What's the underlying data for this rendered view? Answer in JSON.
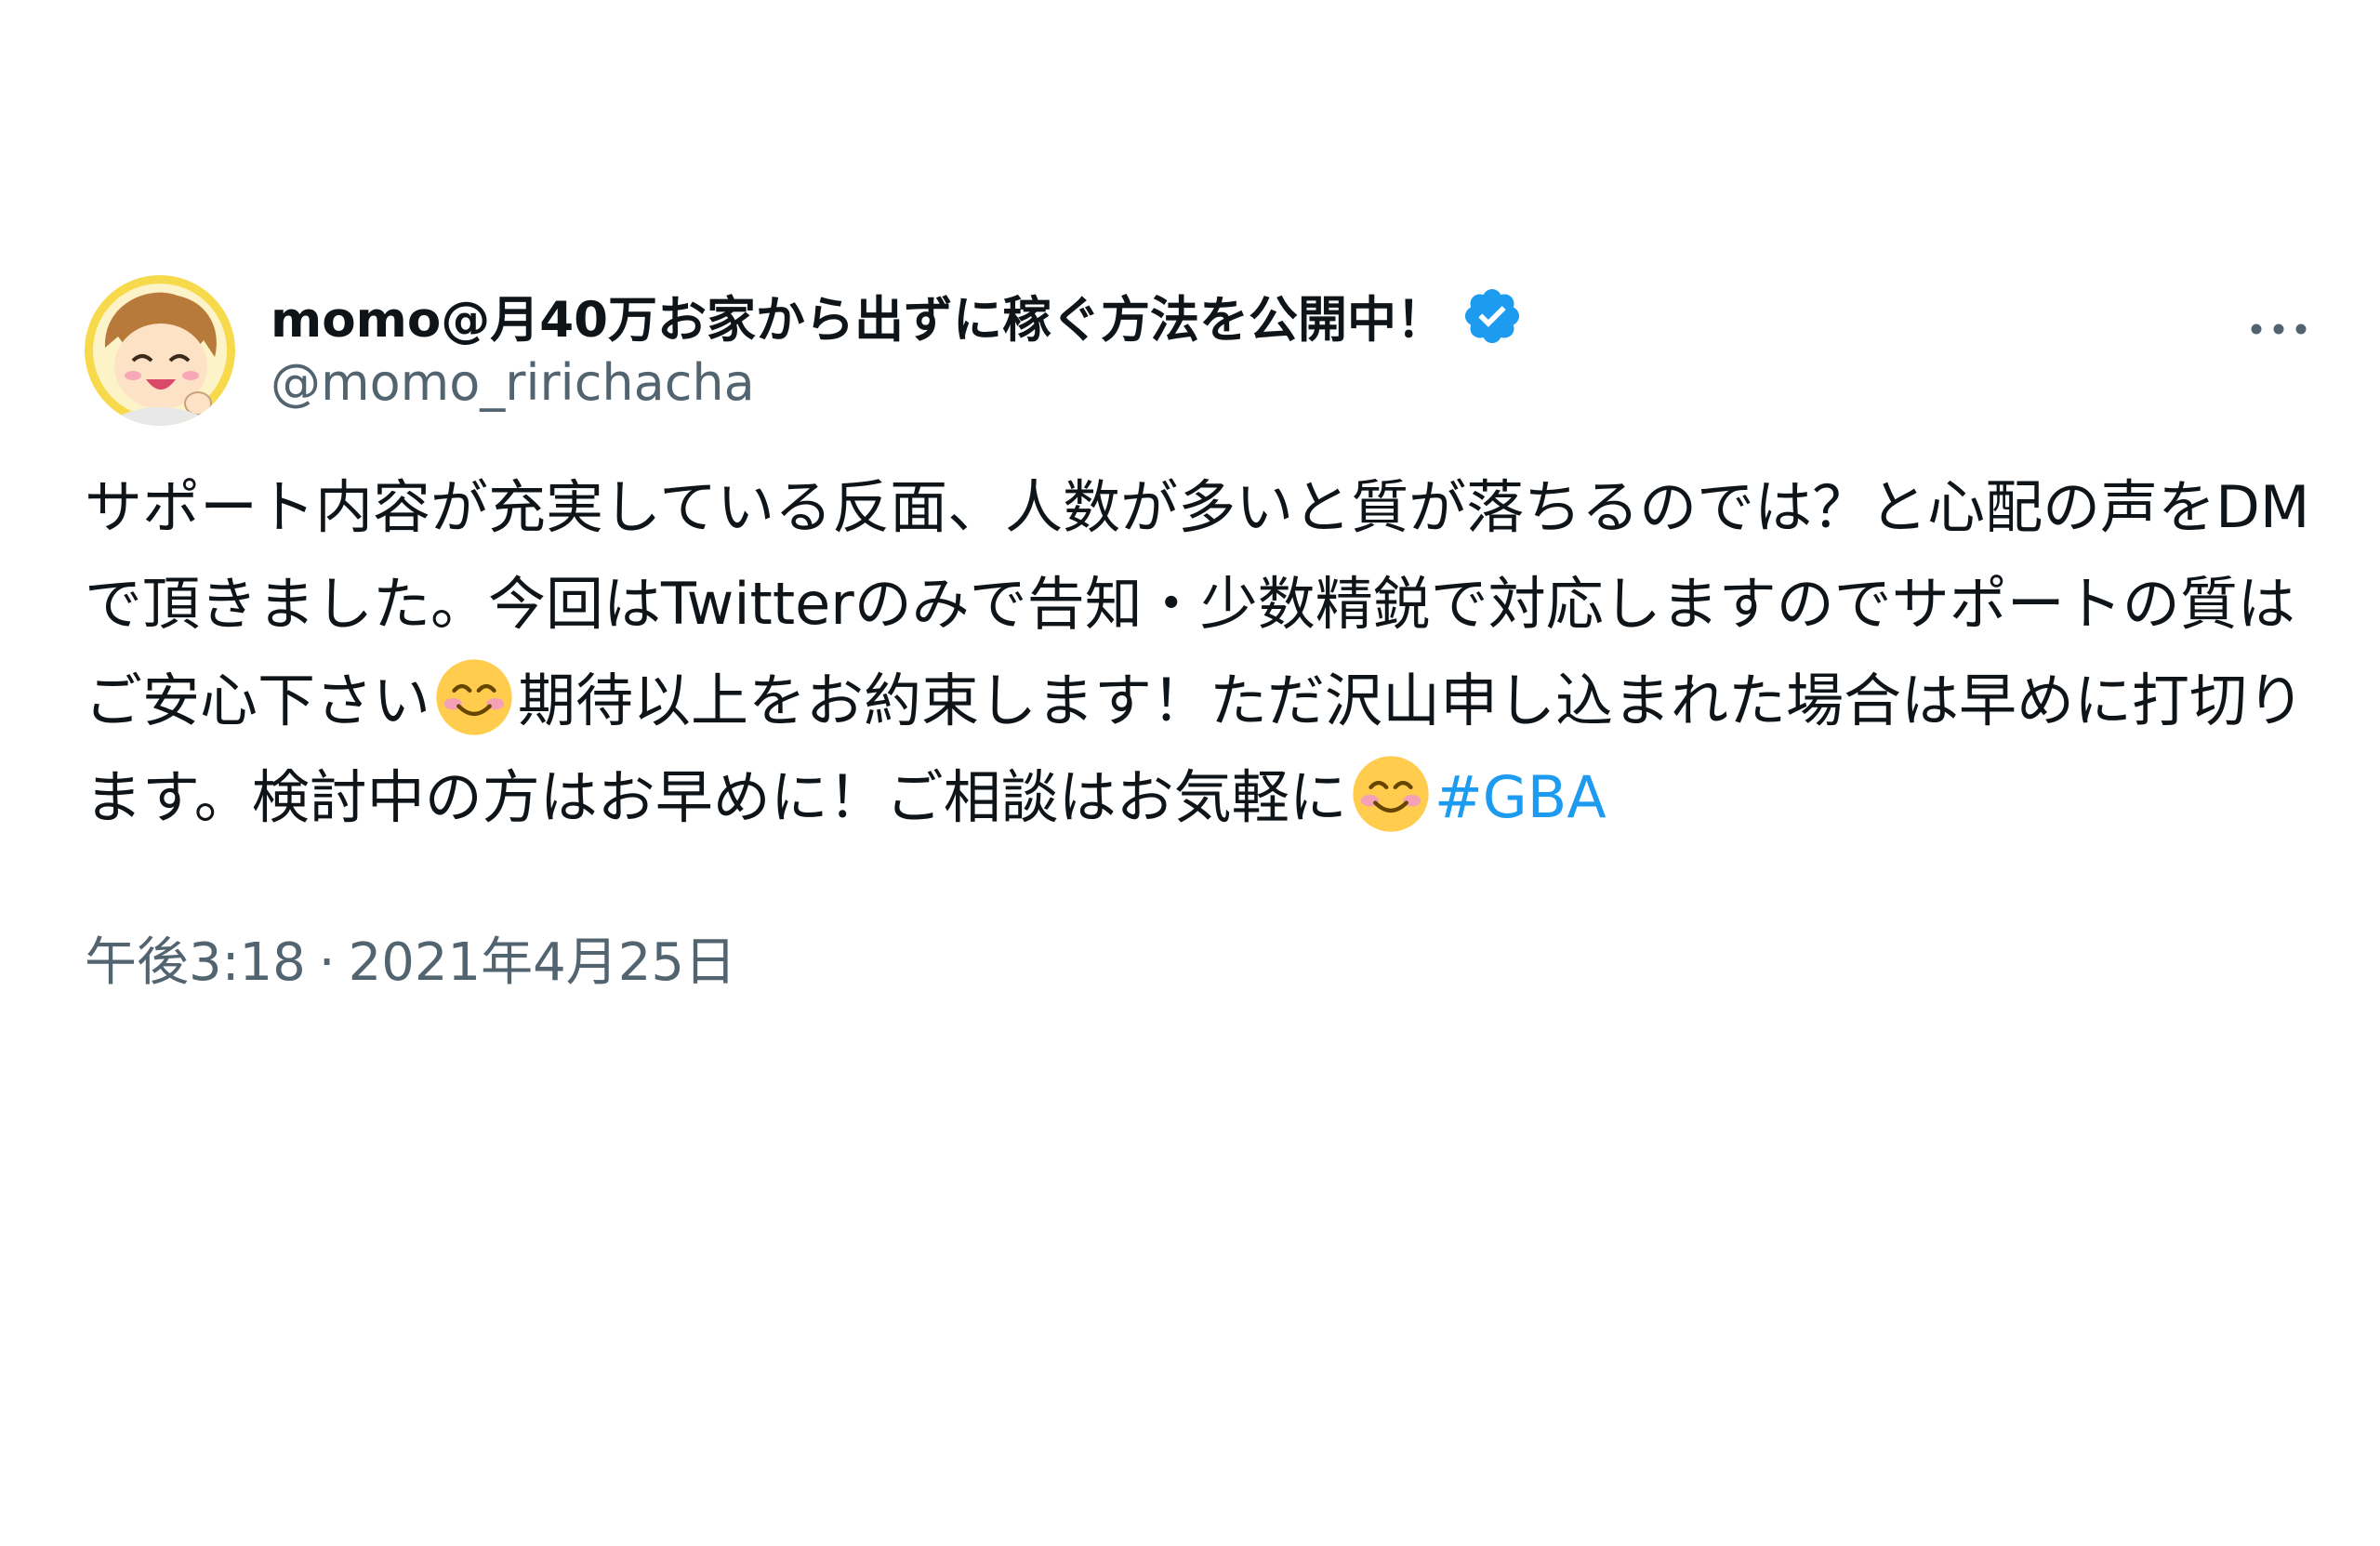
{
  "tweet": {
    "display_name": "momo@月40万お家から出ずに稼ぐ方法を公開中！",
    "handle": "@momo_ririchacha",
    "body_segments": [
      "サポート内容が充実している反面、人数が多いと質が落ちるのでは？と心配の声をDMで頂きました。今回はTwitterのみで告知・少数精鋭で対応しますのでサポートの質はご安心下さい",
      "期待以上をお約束します！ただ沢山申し込まれた場合は早めに打切ります。検討中の方はお早めに！ご相談はお気軽に"
    ],
    "hashtag": "#GBA",
    "time": "午後3:18",
    "separator": "·",
    "date": "2021年4月25日"
  },
  "icons": {
    "avatar": "cartoon-avatar",
    "verified": "verified-badge-icon",
    "more": "more-options-icon",
    "emoji": "smiling-face-with-smiling-eyes-emoji"
  },
  "colors": {
    "text": "#0f1419",
    "secondary": "#536471",
    "link": "#1d9bf0",
    "verified": "#1d9bf0"
  }
}
